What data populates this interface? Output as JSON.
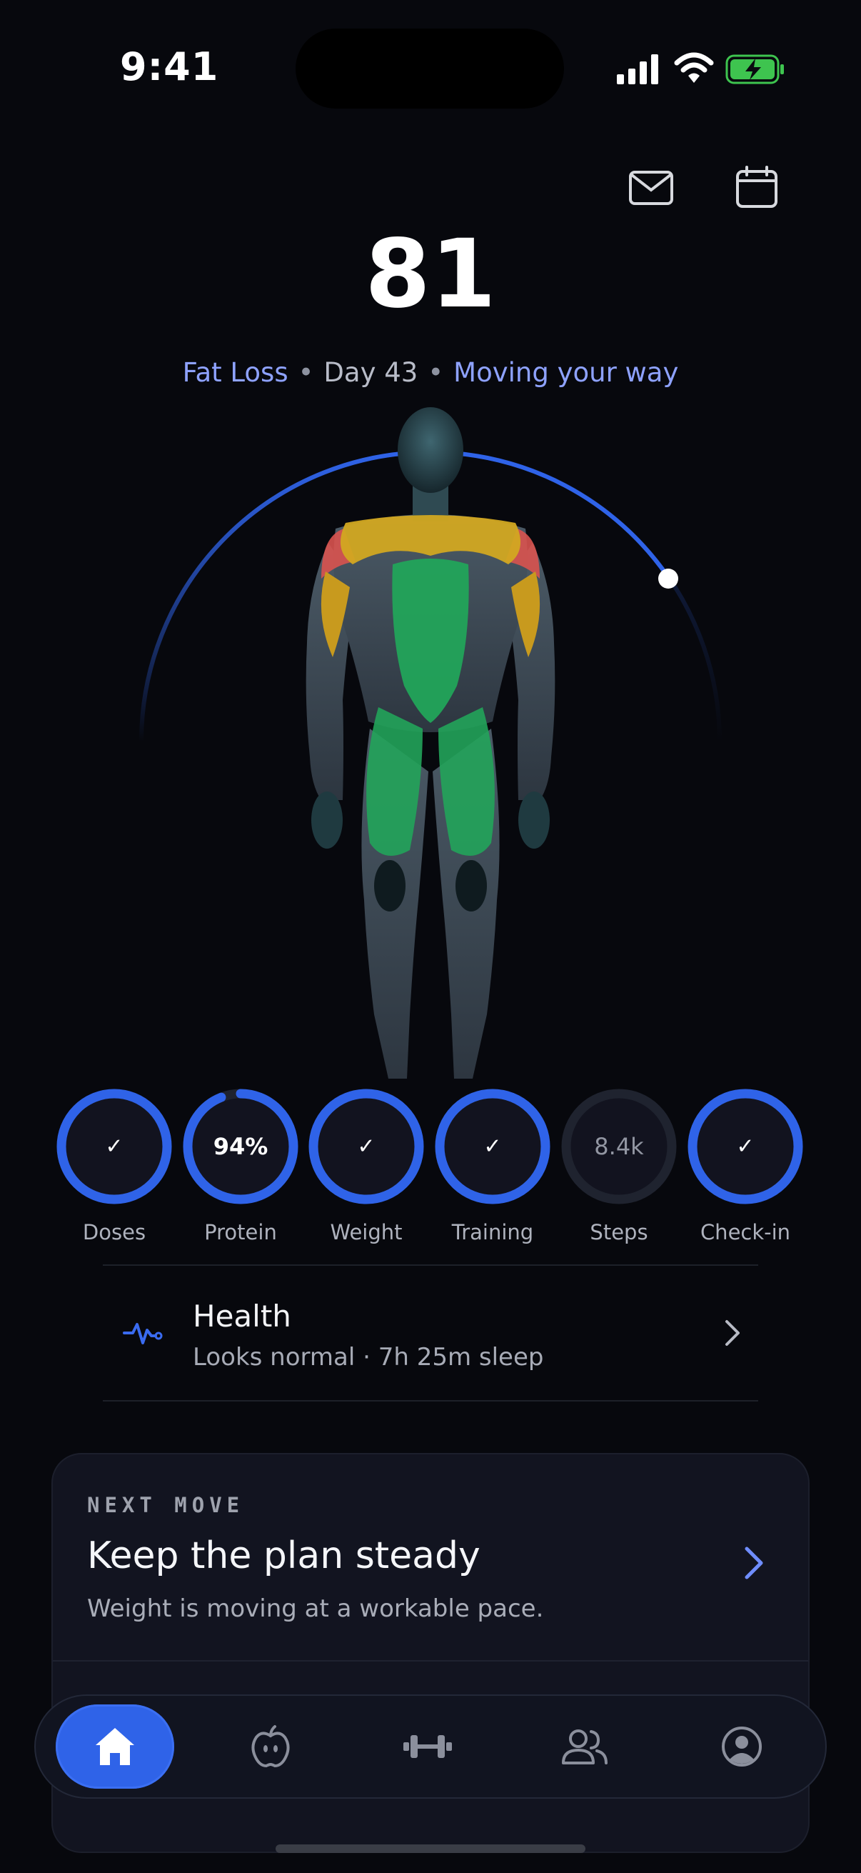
{
  "status_bar": {
    "time": "9:41"
  },
  "header": {
    "mail_icon": "mail-icon",
    "calendar_icon": "calendar-icon"
  },
  "score": {
    "value": "81",
    "goal": "Fat Loss",
    "day": "Day 43",
    "status": "Moving your way",
    "arc_progress": 0.34
  },
  "colors": {
    "accent": "#2f63e8",
    "accent_text": "#8ea2ff",
    "muscle_green": "#22a45a",
    "muscle_yellow": "#d2a821",
    "muscle_red": "#d9534f"
  },
  "rings": [
    {
      "label": "Doses",
      "display": "✓",
      "progress": 1.0
    },
    {
      "label": "Protein",
      "display": "94%",
      "progress": 0.94
    },
    {
      "label": "Weight",
      "display": "✓",
      "progress": 1.0
    },
    {
      "label": "Training",
      "display": "✓",
      "progress": 1.0
    },
    {
      "label": "Steps",
      "display": "8.4k",
      "progress": 0.0
    },
    {
      "label": "Check-in",
      "display": "✓",
      "progress": 1.0
    }
  ],
  "health": {
    "title": "Health",
    "subtitle": "Looks normal · 7h 25m sleep"
  },
  "next_move": {
    "kicker": "NEXT MOVE",
    "title": "Keep the plan steady",
    "description": "Weight is moving at a workable pace."
  },
  "tabbar": {
    "items": [
      {
        "icon": "home-icon",
        "active": true
      },
      {
        "icon": "nutrition-icon",
        "active": false
      },
      {
        "icon": "dumbbell-icon",
        "active": false
      },
      {
        "icon": "community-icon",
        "active": false
      },
      {
        "icon": "profile-icon",
        "active": false
      }
    ]
  }
}
